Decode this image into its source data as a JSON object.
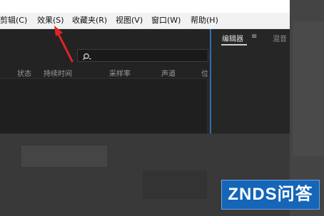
{
  "menu": {
    "items": [
      "剪辑(C)",
      "效果(S)",
      "收藏夹(R)",
      "视图(V)",
      "窗口(W)",
      "帮助(H)"
    ]
  },
  "project_panel": {
    "search_placeholder": "",
    "columns": [
      "状态",
      "持续时间",
      "采样率",
      "声道",
      "位"
    ]
  },
  "right_panel": {
    "tabs": [
      "编辑器",
      "混音"
    ],
    "tab_menu_icon": "≡"
  },
  "watermark": {
    "text": "ZNDS问答"
  },
  "colors": {
    "accent_blue": "#2d6fb5",
    "arrow_red": "#e02424",
    "watermark_bg": "#1565b8"
  }
}
